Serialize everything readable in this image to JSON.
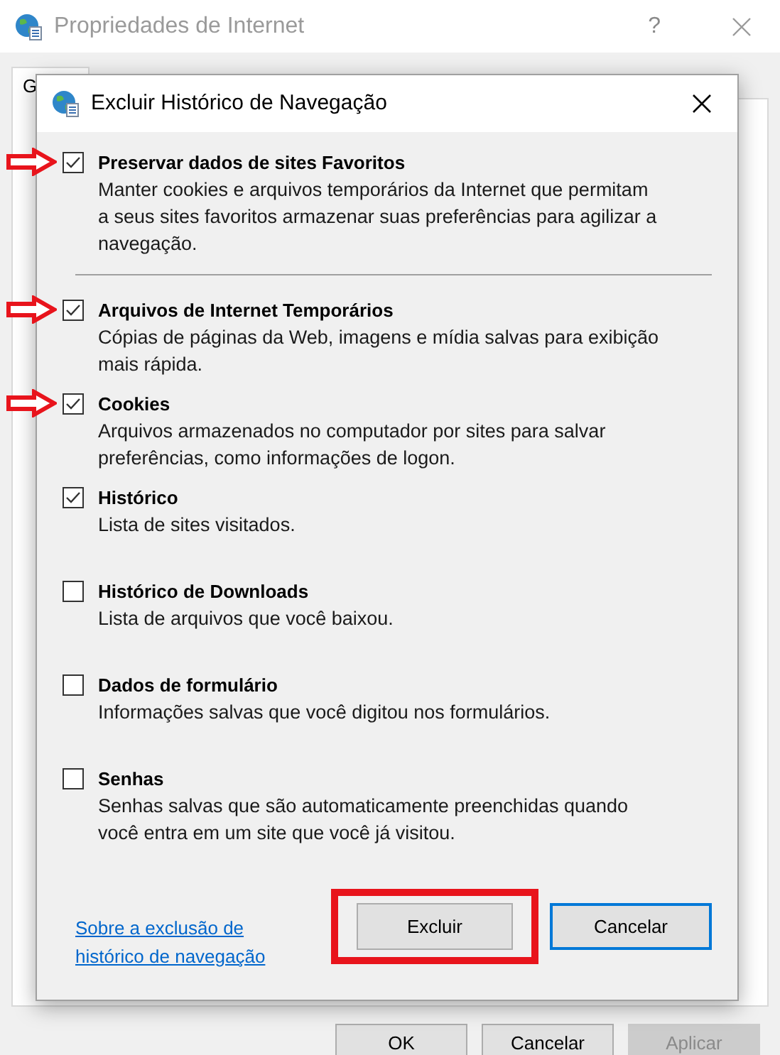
{
  "window": {
    "title": "Propriedades de Internet",
    "help": "?",
    "tabs": [
      {
        "label": "G",
        "selected": true
      }
    ],
    "buttons": [
      {
        "label": "OK",
        "disabled": false
      },
      {
        "label": "Cancelar",
        "disabled": false
      },
      {
        "label": "Aplicar",
        "disabled": true
      }
    ]
  },
  "dialog": {
    "title": "Excluir Histórico de Navegação",
    "options": [
      {
        "label": "Preservar dados de sites Favoritos",
        "description": "Manter cookies e arquivos temporários da Internet que permitam a seus sites favoritos armazenar suas preferências para agilizar a navegação.",
        "checked": true,
        "annotated": true
      },
      {
        "label": "Arquivos de Internet Temporários",
        "description": "Cópias de páginas da Web, imagens e mídia salvas para exibição mais rápida.",
        "checked": true,
        "annotated": true
      },
      {
        "label": "Cookies",
        "description": "Arquivos armazenados no computador por sites para salvar preferências, como informações de logon.",
        "checked": true,
        "annotated": true
      },
      {
        "label": "Histórico",
        "description": "Lista de sites visitados.",
        "checked": true,
        "annotated": false
      },
      {
        "label": "Histórico de Downloads",
        "description": "Lista de arquivos que você baixou.",
        "checked": false,
        "annotated": false
      },
      {
        "label": "Dados de formulário",
        "description": "Informações salvas que você digitou nos formulários.",
        "checked": false,
        "annotated": false
      },
      {
        "label": "Senhas",
        "description": "Senhas salvas que são automaticamente preenchidas quando você entra em um site que você já visitou.",
        "checked": false,
        "annotated": false
      }
    ],
    "link": "Sobre a exclusão de histórico de navegação",
    "buttons": [
      {
        "label": "Excluir",
        "highlighted": true,
        "default": false
      },
      {
        "label": "Cancelar",
        "highlighted": false,
        "default": true
      }
    ]
  }
}
